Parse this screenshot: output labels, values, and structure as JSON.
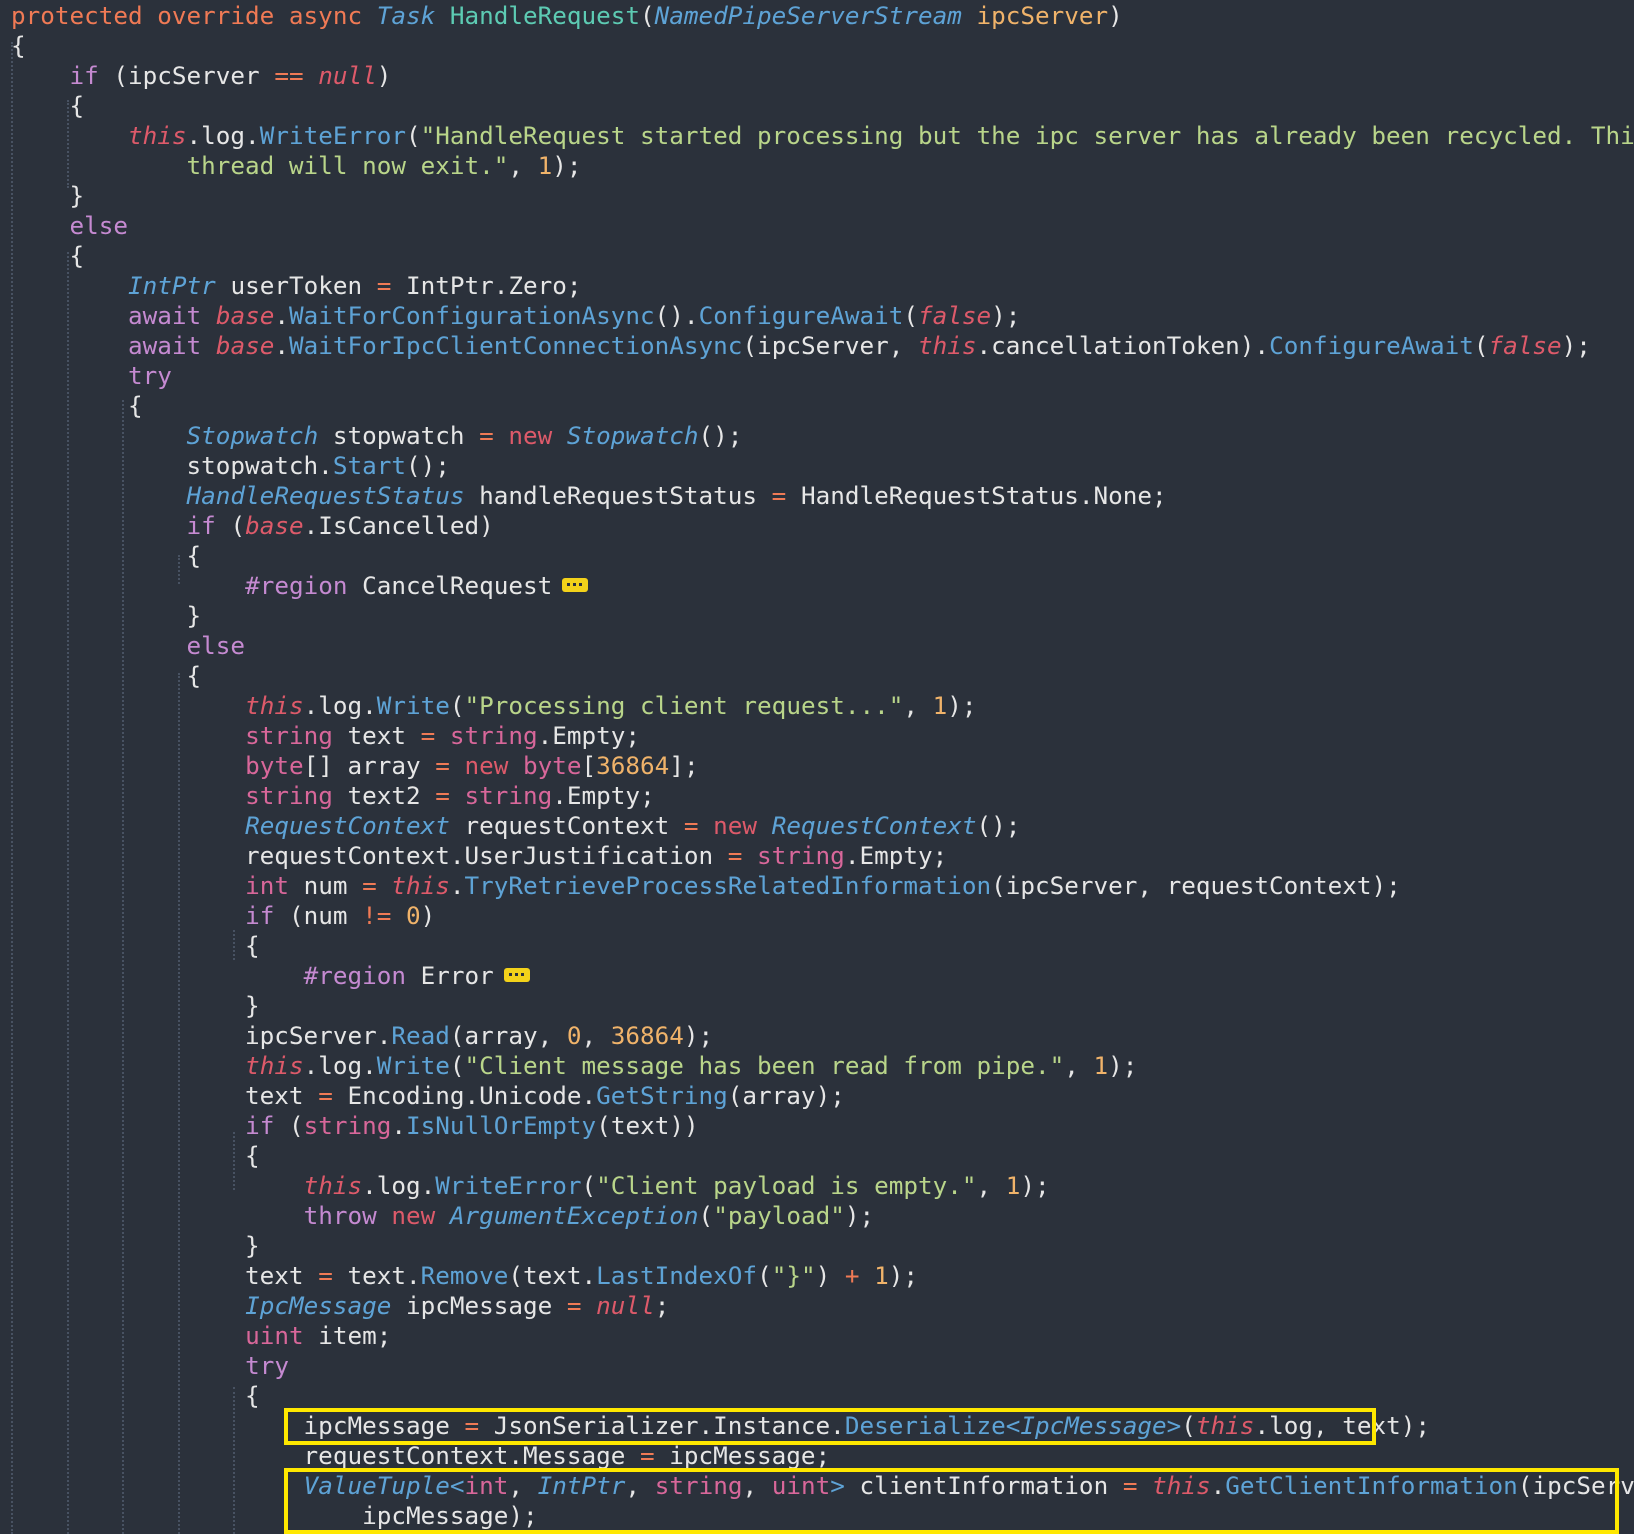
{
  "editor": {
    "lines": [
      [
        [
          "mod",
          "protected override async "
        ],
        [
          "ty",
          "Task "
        ],
        [
          "name",
          "HandleRequest"
        ],
        [
          "pl",
          "("
        ],
        [
          "ty",
          "NamedPipeServerStream "
        ],
        [
          "par",
          "ipcServer"
        ],
        [
          "pl",
          ")"
        ]
      ],
      [
        [
          "pl",
          "{"
        ]
      ],
      [
        [
          "pl",
          "    "
        ],
        [
          "ctl",
          "if "
        ],
        [
          "pl",
          "(ipcServer "
        ],
        [
          "op",
          "== "
        ],
        [
          "ci",
          "null"
        ],
        [
          "pl",
          ")"
        ]
      ],
      [
        [
          "pl",
          "    {"
        ]
      ],
      [
        [
          "pl",
          "        "
        ],
        [
          "ci",
          "this"
        ],
        [
          "pl",
          ".log."
        ],
        [
          "fn",
          "WriteError"
        ],
        [
          "pl",
          "("
        ],
        [
          "str",
          "\"HandleRequest started processing but the ipc server has already been recycled. This"
        ]
      ],
      [
        [
          "str",
          "            thread will now exit.\""
        ],
        [
          "pl",
          ", "
        ],
        [
          "num",
          "1"
        ],
        [
          "pl",
          ");"
        ]
      ],
      [
        [
          "pl",
          "    }"
        ]
      ],
      [
        [
          "pl",
          "    "
        ],
        [
          "ctl",
          "else"
        ]
      ],
      [
        [
          "pl",
          "    {"
        ]
      ],
      [
        [
          "pl",
          "        "
        ],
        [
          "ty",
          "IntPtr "
        ],
        [
          "pl",
          "userToken "
        ],
        [
          "op",
          "= "
        ],
        [
          "pl",
          "IntPtr.Zero;"
        ]
      ],
      [
        [
          "pl",
          "        "
        ],
        [
          "ctl",
          "await "
        ],
        [
          "ci",
          "base"
        ],
        [
          "pl",
          "."
        ],
        [
          "fn",
          "WaitForConfigurationAsync"
        ],
        [
          "pl",
          "()."
        ],
        [
          "fn",
          "ConfigureAwait"
        ],
        [
          "pl",
          "("
        ],
        [
          "ci",
          "false"
        ],
        [
          "pl",
          ");"
        ]
      ],
      [
        [
          "pl",
          "        "
        ],
        [
          "ctl",
          "await "
        ],
        [
          "ci",
          "base"
        ],
        [
          "pl",
          "."
        ],
        [
          "fn",
          "WaitForIpcClientConnectionAsync"
        ],
        [
          "pl",
          "(ipcServer, "
        ],
        [
          "ci",
          "this"
        ],
        [
          "pl",
          ".cancellationToken)."
        ],
        [
          "fn",
          "ConfigureAwait"
        ],
        [
          "pl",
          "("
        ],
        [
          "ci",
          "false"
        ],
        [
          "pl",
          ");"
        ]
      ],
      [
        [
          "pl",
          "        "
        ],
        [
          "ctl",
          "try"
        ]
      ],
      [
        [
          "pl",
          "        {"
        ]
      ],
      [
        [
          "pl",
          "            "
        ],
        [
          "ty",
          "Stopwatch "
        ],
        [
          "pl",
          "stopwatch "
        ],
        [
          "op",
          "= "
        ],
        [
          "ckw",
          "new "
        ],
        [
          "ty",
          "Stopwatch"
        ],
        [
          "pl",
          "();"
        ]
      ],
      [
        [
          "pl",
          "            stopwatch."
        ],
        [
          "fn",
          "Start"
        ],
        [
          "pl",
          "();"
        ]
      ],
      [
        [
          "pl",
          "            "
        ],
        [
          "ty",
          "HandleRequestStatus "
        ],
        [
          "pl",
          "handleRequestStatus "
        ],
        [
          "op",
          "= "
        ],
        [
          "pl",
          "HandleRequestStatus.None;"
        ]
      ],
      [
        [
          "pl",
          "            "
        ],
        [
          "ctl",
          "if "
        ],
        [
          "pl",
          "("
        ],
        [
          "ci",
          "base"
        ],
        [
          "pl",
          ".IsCancelled)"
        ]
      ],
      [
        [
          "pl",
          "            {"
        ]
      ],
      [
        [
          "pl",
          "                "
        ],
        [
          "pre",
          "#region "
        ],
        [
          "pl",
          "CancelRequest"
        ]
      ],
      [
        [
          "pl",
          "            }"
        ]
      ],
      [
        [
          "pl",
          "            "
        ],
        [
          "ctl",
          "else"
        ]
      ],
      [
        [
          "pl",
          "            {"
        ]
      ],
      [
        [
          "pl",
          "                "
        ],
        [
          "ci",
          "this"
        ],
        [
          "pl",
          ".log."
        ],
        [
          "fn",
          "Write"
        ],
        [
          "pl",
          "("
        ],
        [
          "str",
          "\"Processing client request...\""
        ],
        [
          "pl",
          ", "
        ],
        [
          "num",
          "1"
        ],
        [
          "pl",
          ");"
        ]
      ],
      [
        [
          "pl",
          "                "
        ],
        [
          "kw",
          "string "
        ],
        [
          "pl",
          "text "
        ],
        [
          "op",
          "= "
        ],
        [
          "kw",
          "string"
        ],
        [
          "pl",
          ".Empty;"
        ]
      ],
      [
        [
          "pl",
          "                "
        ],
        [
          "kw",
          "byte"
        ],
        [
          "pl",
          "[] array "
        ],
        [
          "op",
          "= "
        ],
        [
          "ckw",
          "new "
        ],
        [
          "kw",
          "byte"
        ],
        [
          "pl",
          "["
        ],
        [
          "num",
          "36864"
        ],
        [
          "pl",
          "];"
        ]
      ],
      [
        [
          "pl",
          "                "
        ],
        [
          "kw",
          "string "
        ],
        [
          "pl",
          "text2 "
        ],
        [
          "op",
          "= "
        ],
        [
          "kw",
          "string"
        ],
        [
          "pl",
          ".Empty;"
        ]
      ],
      [
        [
          "pl",
          "                "
        ],
        [
          "ty",
          "RequestContext "
        ],
        [
          "pl",
          "requestContext "
        ],
        [
          "op",
          "= "
        ],
        [
          "ckw",
          "new "
        ],
        [
          "ty",
          "RequestContext"
        ],
        [
          "pl",
          "();"
        ]
      ],
      [
        [
          "pl",
          "                requestContext.UserJustification "
        ],
        [
          "op",
          "= "
        ],
        [
          "kw",
          "string"
        ],
        [
          "pl",
          ".Empty;"
        ]
      ],
      [
        [
          "pl",
          "                "
        ],
        [
          "kw",
          "int "
        ],
        [
          "pl",
          "num "
        ],
        [
          "op",
          "= "
        ],
        [
          "ci",
          "this"
        ],
        [
          "pl",
          "."
        ],
        [
          "fn",
          "TryRetrieveProcessRelatedInformation"
        ],
        [
          "pl",
          "(ipcServer, requestContext);"
        ]
      ],
      [
        [
          "pl",
          "                "
        ],
        [
          "ctl",
          "if "
        ],
        [
          "pl",
          "(num "
        ],
        [
          "op",
          "!= "
        ],
        [
          "num",
          "0"
        ],
        [
          "pl",
          ")"
        ]
      ],
      [
        [
          "pl",
          "                {"
        ]
      ],
      [
        [
          "pl",
          "                    "
        ],
        [
          "pre",
          "#region "
        ],
        [
          "pl",
          "Error"
        ]
      ],
      [
        [
          "pl",
          "                }"
        ]
      ],
      [
        [
          "pl",
          "                ipcServer."
        ],
        [
          "fn",
          "Read"
        ],
        [
          "pl",
          "(array, "
        ],
        [
          "num",
          "0"
        ],
        [
          "pl",
          ", "
        ],
        [
          "num",
          "36864"
        ],
        [
          "pl",
          ");"
        ]
      ],
      [
        [
          "pl",
          "                "
        ],
        [
          "ci",
          "this"
        ],
        [
          "pl",
          ".log."
        ],
        [
          "fn",
          "Write"
        ],
        [
          "pl",
          "("
        ],
        [
          "str",
          "\"Client message has been read from pipe.\""
        ],
        [
          "pl",
          ", "
        ],
        [
          "num",
          "1"
        ],
        [
          "pl",
          ");"
        ]
      ],
      [
        [
          "pl",
          "                text "
        ],
        [
          "op",
          "= "
        ],
        [
          "pl",
          "Encoding.Unicode."
        ],
        [
          "fn",
          "GetString"
        ],
        [
          "pl",
          "(array);"
        ]
      ],
      [
        [
          "pl",
          "                "
        ],
        [
          "ctl",
          "if "
        ],
        [
          "pl",
          "("
        ],
        [
          "kw",
          "string"
        ],
        [
          "pl",
          "."
        ],
        [
          "fn",
          "IsNullOrEmpty"
        ],
        [
          "pl",
          "(text))"
        ]
      ],
      [
        [
          "pl",
          "                {"
        ]
      ],
      [
        [
          "pl",
          "                    "
        ],
        [
          "ci",
          "this"
        ],
        [
          "pl",
          ".log."
        ],
        [
          "fn",
          "WriteError"
        ],
        [
          "pl",
          "("
        ],
        [
          "str",
          "\"Client payload is empty.\""
        ],
        [
          "pl",
          ", "
        ],
        [
          "num",
          "1"
        ],
        [
          "pl",
          ");"
        ]
      ],
      [
        [
          "pl",
          "                    "
        ],
        [
          "ctl",
          "throw "
        ],
        [
          "ckw",
          "new "
        ],
        [
          "ty",
          "ArgumentException"
        ],
        [
          "pl",
          "("
        ],
        [
          "str",
          "\"payload\""
        ],
        [
          "pl",
          ");"
        ]
      ],
      [
        [
          "pl",
          "                }"
        ]
      ],
      [
        [
          "pl",
          "                text "
        ],
        [
          "op",
          "= "
        ],
        [
          "pl",
          "text."
        ],
        [
          "fn",
          "Remove"
        ],
        [
          "pl",
          "(text."
        ],
        [
          "fn",
          "LastIndexOf"
        ],
        [
          "pl",
          "("
        ],
        [
          "str",
          "\"}\""
        ],
        [
          "pl",
          ") "
        ],
        [
          "op",
          "+ "
        ],
        [
          "num",
          "1"
        ],
        [
          "pl",
          ");"
        ]
      ],
      [
        [
          "pl",
          "                "
        ],
        [
          "ty",
          "IpcMessage "
        ],
        [
          "pl",
          "ipcMessage "
        ],
        [
          "op",
          "= "
        ],
        [
          "ci",
          "null"
        ],
        [
          "pl",
          ";"
        ]
      ],
      [
        [
          "pl",
          "                "
        ],
        [
          "kw",
          "uint "
        ],
        [
          "pl",
          "item;"
        ]
      ],
      [
        [
          "pl",
          "                "
        ],
        [
          "ctl",
          "try"
        ]
      ],
      [
        [
          "pl",
          "                {"
        ]
      ],
      [
        [
          "pl",
          "                    ipcMessage "
        ],
        [
          "op",
          "= "
        ],
        [
          "pl",
          "JsonSerializer.Instance."
        ],
        [
          "fn",
          "Deserialize"
        ],
        [
          "ty",
          "<IpcMessage>"
        ],
        [
          "pl",
          "("
        ],
        [
          "ci",
          "this"
        ],
        [
          "pl",
          ".log, text);"
        ]
      ],
      [
        [
          "pl",
          "                    requestContext.Message "
        ],
        [
          "op",
          "= "
        ],
        [
          "pl",
          "ipcMessage;"
        ]
      ],
      [
        [
          "pl",
          "                    "
        ],
        [
          "ty",
          "ValueTuple"
        ],
        [
          "fn",
          "<"
        ],
        [
          "kw",
          "int"
        ],
        [
          "pl",
          ", "
        ],
        [
          "ty",
          "IntPtr"
        ],
        [
          "pl",
          ", "
        ],
        [
          "kw",
          "string"
        ],
        [
          "pl",
          ", "
        ],
        [
          "kw",
          "uint"
        ],
        [
          "fn",
          "> "
        ],
        [
          "pl",
          "clientInformation "
        ],
        [
          "op",
          "= "
        ],
        [
          "ci",
          "this"
        ],
        [
          "pl",
          "."
        ],
        [
          "fn",
          "GetClientInformation"
        ],
        [
          "pl",
          "(ipcServer,"
        ]
      ],
      [
        [
          "pl",
          "                        ipcMessage);"
        ]
      ]
    ]
  }
}
